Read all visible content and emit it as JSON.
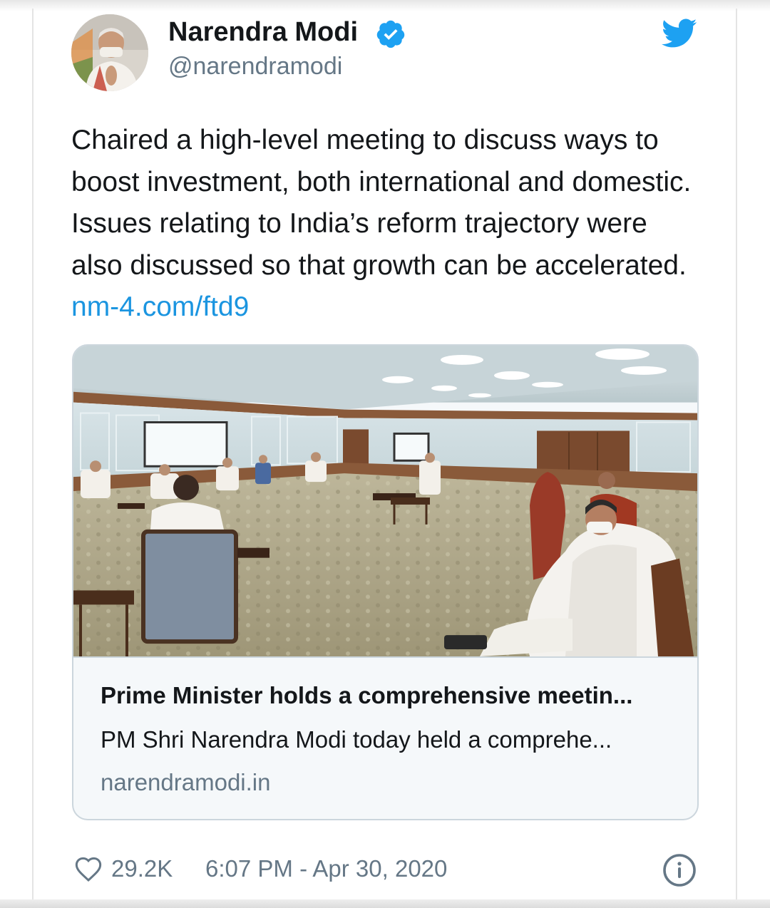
{
  "author": {
    "name": "Narendra Modi",
    "handle": "@narendramodi",
    "verified_icon": "verified-badge-icon",
    "avatar": "avatar-photo"
  },
  "brand": {
    "icon": "twitter-bird-icon",
    "color": "#1da1f2"
  },
  "tweet": {
    "text": "Chaired a high-level meeting to discuss ways to boost investment, both international and domestic. Issues relating to India’s reform trajectory were also discussed so that growth can be accelerated. ",
    "link": "nm-4.com/ftd9",
    "link_color": "#1b95e0"
  },
  "card": {
    "image": "meeting-room-photo",
    "title": "Prime Minister holds a comprehensive meetin...",
    "description": "PM Shri Narendra Modi today held a comprehe...",
    "domain": "narendramodi.in"
  },
  "footer": {
    "like_icon": "heart-icon",
    "likes": "29.2K",
    "timestamp": "6:07 PM - Apr 30, 2020",
    "info_icon": "info-icon"
  }
}
